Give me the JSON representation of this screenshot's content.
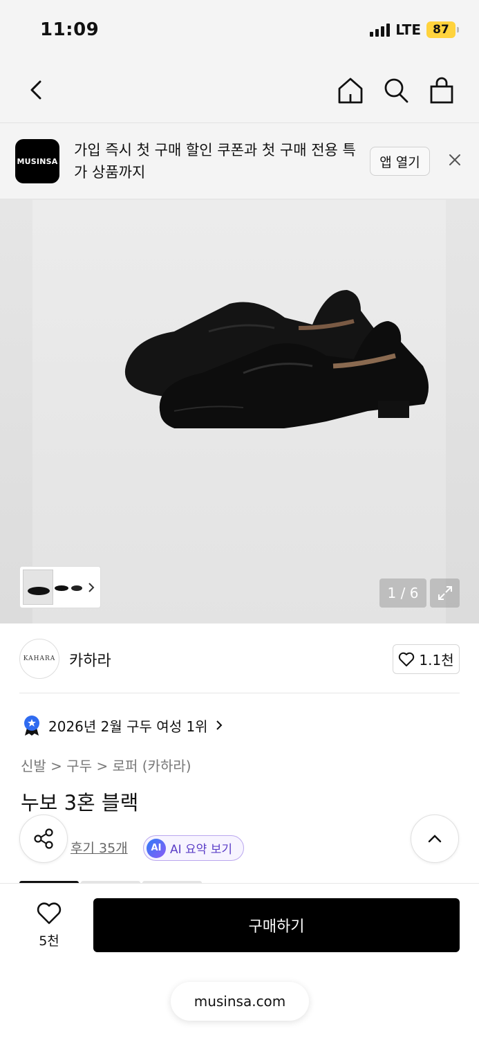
{
  "status_bar": {
    "time": "11:09",
    "network": "LTE",
    "battery": "87"
  },
  "nav": {
    "back_icon": "chevron-left-icon",
    "icons": [
      "home-icon",
      "search-icon",
      "shopping-bag-icon"
    ]
  },
  "banner": {
    "logo_text": "MUSINSA",
    "message": "가입 즉시 첫 구매 할인 쿠폰과 첫 구매 전용 특가 상품까지",
    "open_app_label": "앱 열기",
    "close_icon": "close-icon"
  },
  "gallery": {
    "counter": "1 / 6",
    "expand_icon": "expand-icon"
  },
  "brand": {
    "logo_text": "KAHARA",
    "name": "카하라",
    "like_count": "1.1천"
  },
  "ranking": {
    "text": "2026년 2월 구두 여성 1위"
  },
  "breadcrumb": {
    "items": [
      "신발",
      "구두",
      "로퍼 (카하라)"
    ],
    "separator": ">"
  },
  "product": {
    "title": "누보 3혼 블랙",
    "reviews": "후기 35개",
    "ai_badge": "AI",
    "ai_summary": "AI 요약 보기"
  },
  "bottom_bar": {
    "wish_count": "5천",
    "buy_label": "구매하기",
    "url": "musinsa.com"
  },
  "colors": {
    "accent": "#000000",
    "battery": "#ffd33d",
    "ai": "#5b3ec7",
    "rank_badge": "#2f6bf0"
  }
}
